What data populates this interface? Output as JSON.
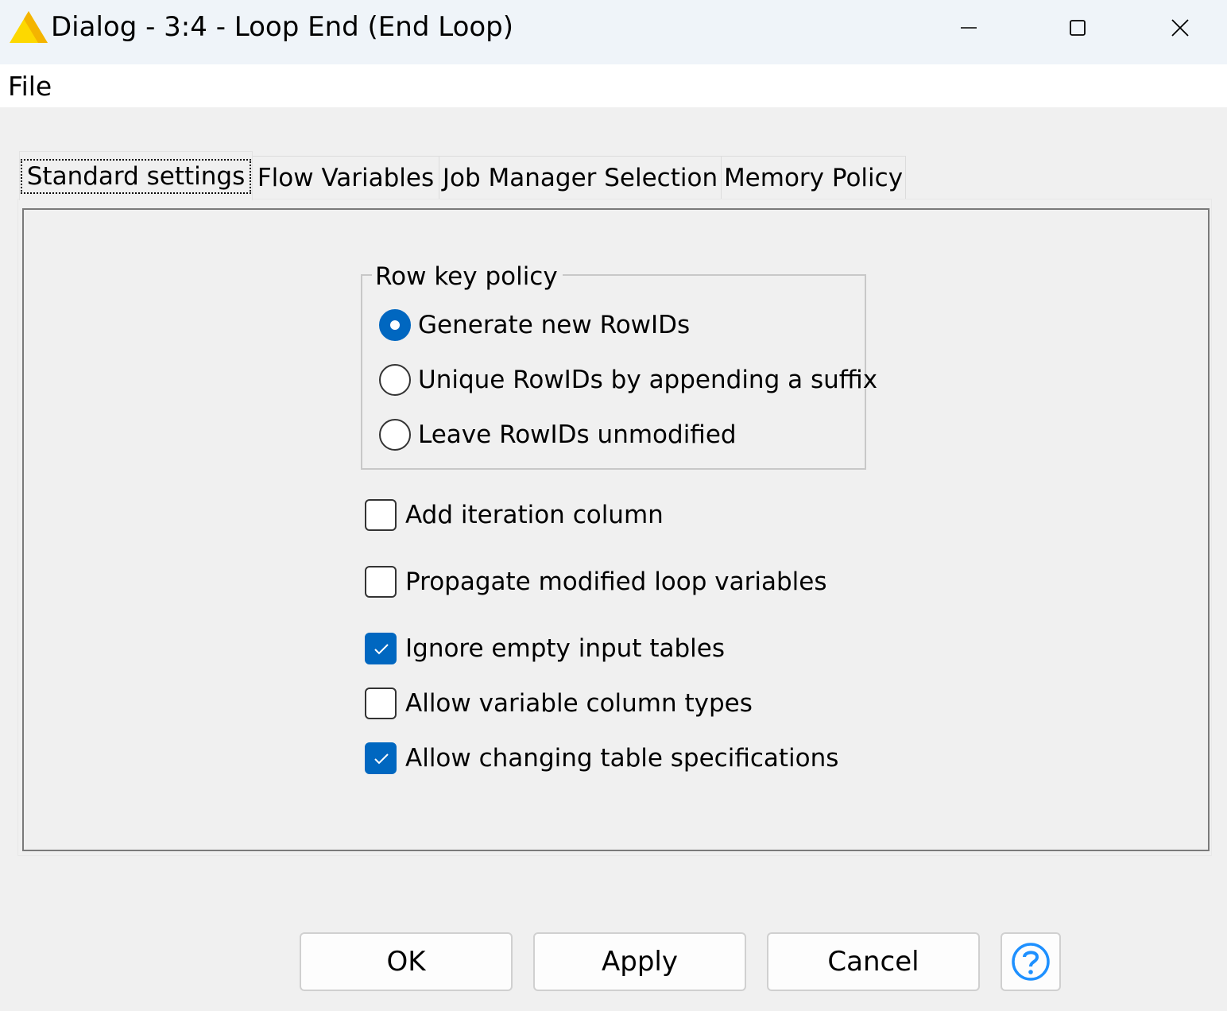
{
  "window": {
    "title": "Dialog - 3:4 - Loop End (End Loop)",
    "accent_color": "#0067c0"
  },
  "menubar": {
    "file_label": "File"
  },
  "tabs": [
    {
      "label": "Standard settings",
      "active": true
    },
    {
      "label": "Flow Variables",
      "active": false
    },
    {
      "label": "Job Manager Selection",
      "active": false
    },
    {
      "label": "Memory Policy",
      "active": false
    }
  ],
  "row_key_policy": {
    "title": "Row key policy",
    "options": [
      {
        "label": "Generate new RowIDs",
        "selected": true
      },
      {
        "label": "Unique RowIDs by appending a suffix",
        "selected": false
      },
      {
        "label": "Leave RowIDs unmodified",
        "selected": false
      }
    ]
  },
  "options": [
    {
      "label": "Add iteration column",
      "checked": false
    },
    {
      "label": "Propagate modified loop variables",
      "checked": false
    },
    {
      "label": "Ignore empty input tables",
      "checked": true
    },
    {
      "label": "Allow variable column types",
      "checked": false
    },
    {
      "label": "Allow changing table specifications",
      "checked": true
    }
  ],
  "buttons": {
    "ok": "OK",
    "apply": "Apply",
    "cancel": "Cancel",
    "help_icon": "help-icon"
  }
}
